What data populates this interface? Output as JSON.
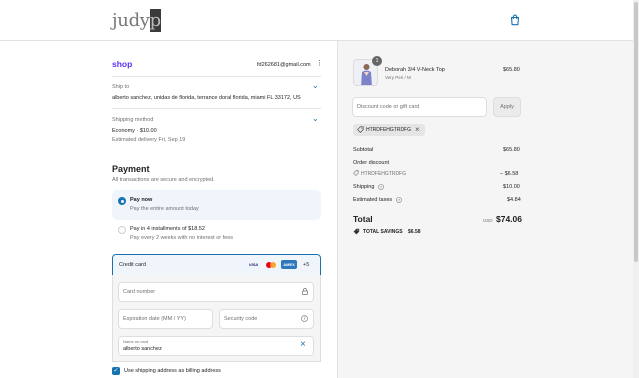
{
  "header": {
    "logo_text": "judy",
    "logo_block_letter": "p",
    "cart_icon": "shopping-bag-icon"
  },
  "contact": {
    "shop_label": "shop",
    "email": "fd262681@gmail.com",
    "menu_icon": "kebab-icon"
  },
  "ship_to": {
    "label": "Ship to",
    "value": "alberto sanchez, unidas de florida, terrance doral florida, miami FL 33172, US"
  },
  "shipping_method": {
    "label": "Shipping method",
    "value": "Economy · $10.00",
    "estimate": "Estimated delivery Fri, Sep 19"
  },
  "payment": {
    "title": "Payment",
    "subtitle": "All transactions are secure and encrypted.",
    "options": [
      {
        "title": "Pay now",
        "desc": "Pay the entire amount today",
        "selected": true
      },
      {
        "title": "Pay in 4 installments of $18.52",
        "desc": "Pay every 2 weeks with no interest or fees",
        "selected": false
      }
    ],
    "method_label": "Credit card",
    "card_brands": [
      "VISA",
      "mastercard",
      "AMEX"
    ],
    "more_brands": "+5",
    "card_number_placeholder": "Card number",
    "expiry_placeholder": "Expiration date (MM / YY)",
    "security_placeholder": "Security code",
    "name_label": "Name on card",
    "name_value": "alberto sanchez",
    "billing_label": "Use shipping address as billing address",
    "billing_checked": true
  },
  "summary": {
    "product": {
      "qty_badge": "1",
      "name": "Deborah 3/4 V-Neck Top",
      "variant": "Very Peri / M",
      "price": "$65.80"
    },
    "discount_placeholder": "Discount code or gift card",
    "apply_label": "Apply",
    "applied_code": "HTRDFEHGTRDFG",
    "subtotal_label": "Subtotal",
    "subtotal_value": "$65.80",
    "order_discount_label": "Order discount",
    "discount_code": "HTRDFEHGTRDFG",
    "discount_value": "– $6.58",
    "shipping_label": "Shipping",
    "shipping_value": "$10.00",
    "taxes_label": "Estimated taxes",
    "taxes_value": "$4.84",
    "total_label": "Total",
    "currency": "USD",
    "total_value": "$74.06",
    "savings_label": "TOTAL SAVINGS",
    "savings_value": "$6.58"
  },
  "colors": {
    "accent": "#1773b0",
    "selected_bg": "#f0f5fb",
    "brand_purple": "#5a31f4"
  }
}
